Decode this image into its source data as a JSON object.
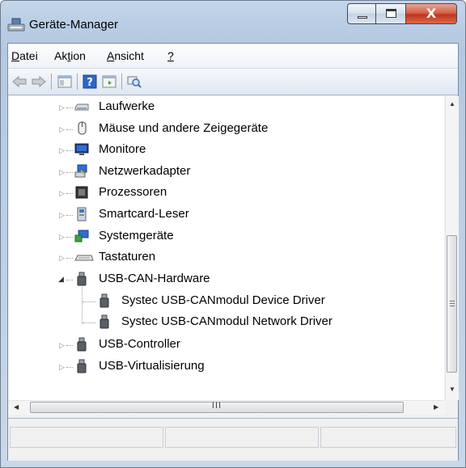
{
  "window": {
    "title": "Geräte-Manager",
    "close_glyph": "X"
  },
  "menu": {
    "items": [
      {
        "label": "Datei",
        "accel": "D",
        "rest": "atei"
      },
      {
        "label": "Aktion",
        "pre": "Ak",
        "accel": "t",
        "rest": "ion"
      },
      {
        "label": "Ansicht",
        "accel": "A",
        "rest": "nsicht"
      },
      {
        "label": "?",
        "accel": "?"
      }
    ]
  },
  "toolbar": {
    "buttons": [
      "back-arrow-icon",
      "forward-arrow-icon",
      "properties-icon",
      "help-icon",
      "show-hide-tree-icon",
      "scan-hardware-icon"
    ]
  },
  "tree": {
    "items": [
      {
        "label": "Laufwerke",
        "icon": "disk-drive-icon",
        "state": "collapsed"
      },
      {
        "label": "Mäuse und andere Zeigegeräte",
        "icon": "mouse-icon",
        "state": "collapsed"
      },
      {
        "label": "Monitore",
        "icon": "monitor-icon",
        "state": "collapsed"
      },
      {
        "label": "Netzwerkadapter",
        "icon": "network-adapter-icon",
        "state": "collapsed"
      },
      {
        "label": "Prozessoren",
        "icon": "processor-icon",
        "state": "collapsed"
      },
      {
        "label": "Smartcard-Leser",
        "icon": "smartcard-reader-icon",
        "state": "collapsed"
      },
      {
        "label": "Systemgeräte",
        "icon": "system-device-icon",
        "state": "collapsed"
      },
      {
        "label": "Tastaturen",
        "icon": "keyboard-icon",
        "state": "collapsed"
      },
      {
        "label": "USB-CAN-Hardware",
        "icon": "usb-plug-icon",
        "state": "expanded",
        "children": [
          {
            "label": "Systec USB-CANmodul Device Driver",
            "icon": "usb-plug-icon"
          },
          {
            "label": "Systec USB-CANmodul Network Driver",
            "icon": "usb-plug-icon"
          }
        ]
      },
      {
        "label": "USB-Controller",
        "icon": "usb-plug-icon",
        "state": "collapsed"
      },
      {
        "label": "USB-Virtualisierung",
        "icon": "usb-plug-icon",
        "state": "collapsed"
      }
    ]
  },
  "scrollbar": {
    "h_thumb_grip": "III",
    "vertical_position": 0.53
  }
}
